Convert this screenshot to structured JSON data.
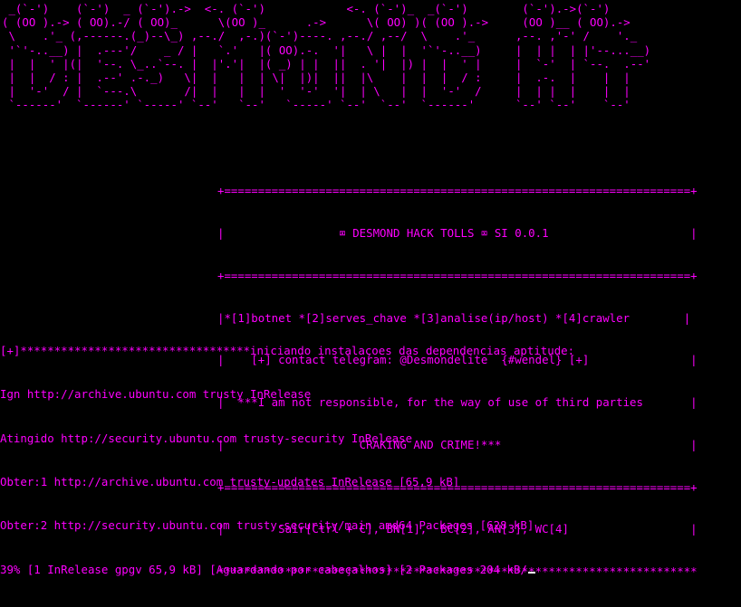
{
  "colors": {
    "background": "#000000",
    "accent": "#ff00ff",
    "cursor": "#ffffff"
  },
  "banner": {
    "ascii_art": " _(`-')    (`-')  _ (`-').->  <-. (`-')            <-. (`-')_  _(`-')        (`-').->(`-')\n( (OO ).-> ( OO).-/ ( OO)_      \\(OO )_      .->      \\( OO) )( (OO ).->     (OO )__ ( OO).->\n \\    .'_ (,------.(_)--\\_) ,--./  ,-.)(`-')----. ,--./ ,--/  \\    .'_      ,--. ,'-' /    '._\n '`'-..__) |  .---'/    _ / |   `.'   |( OO).-.  '|   \\ |  |  '`'-..__)     |  | |  | |'--...__)\n |  |  ' |(|  '--. \\_..`--. |  |'.'|  |( _) | |  ||  . '|  |) |  |  ' |     |  `-'  | `--.  .--'\n |  |  / : |  .--' .-._)   \\|  |   |  | \\|  |)|  ||  |\\    |  |  |  / :     |  .-.  |    |  |\n |  '-'  / |  `---.\\       /|  |   |  |  '  '-'  '|  | \\   |  |  '-'  /     |  | |  |    |  |\n `------'  `------' `-----' `--'   `--'   `-----' `--'  `--'  `------'      `--' `--'    `--'"
  },
  "menu": {
    "border_eq": "+=====================================================================+",
    "title": "|                 ⌧ DESMOND HACK TOLLS ⌧ SI 0.0.1                     |",
    "options": "|*[1]botnet *[2]serves_chave *[3]analise(ip/host) *[4]crawler        |",
    "contact": "|    [+] contact telegram: @Desmondelite  {#wendel} [+]               |",
    "disclaimer1": "|  ***I am not responsible, for the way of use of third parties       |",
    "disclaimer2": "|                    CRAKING AND CRIME!***                            |",
    "exit_line": "|        Sair[Ctrl + C], BN[1],  BC[2], AN[3], WC[4]                  |",
    "border_star": "***********************************************************************"
  },
  "output": {
    "line1": "[+]**********************************iniciando instalaçoes das dependencias aptitude:",
    "line2": "Ign http://archive.ubuntu.com trusty InRelease",
    "line3": "Atingido http://security.ubuntu.com trusty-security InRelease",
    "line4": "Obter:1 http://archive.ubuntu.com trusty-updates InRelease [65,9 kB]",
    "line5": "Obter:2 http://security.ubuntu.com trusty-security/main amd64 Packages [628 kB]",
    "line6": "39% [1 InRelease gpgv 65,9 kB] [Aguardando por cabeçalhos] [2 Packages 204 kB/"
  }
}
